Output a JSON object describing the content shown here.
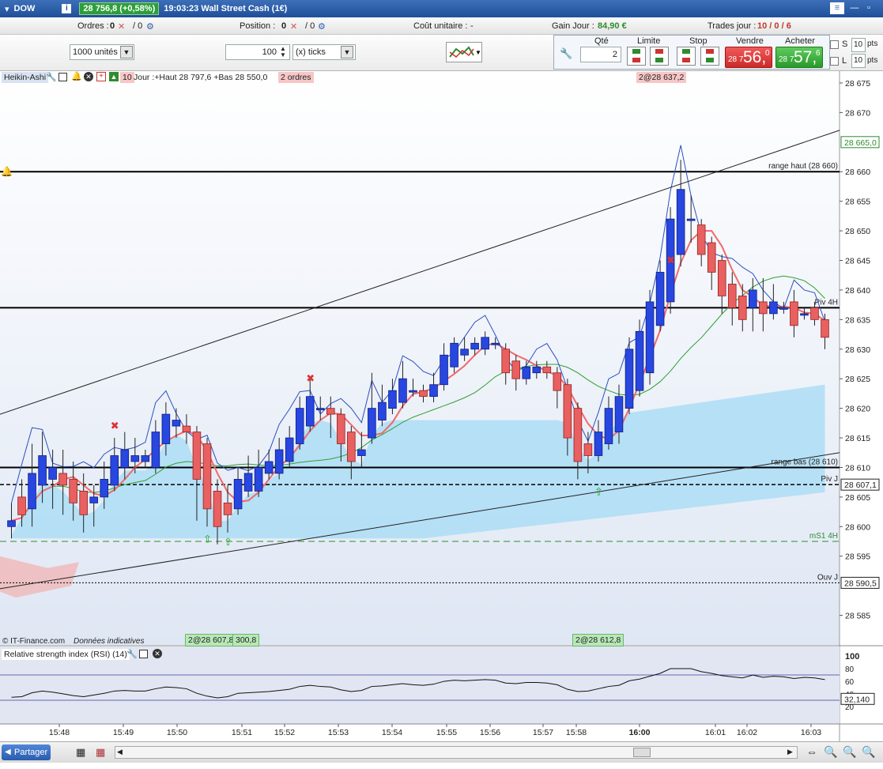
{
  "titlebar": {
    "instrument": "DOW",
    "price": "28 756,8 (+0,58%)",
    "info": "19:03:23 Wall Street Cash (1€)"
  },
  "status": {
    "orders_label": "Ordres :",
    "orders_val": "0",
    "orders_val2": "/ 0",
    "position_label": "Position :",
    "position_val": "0",
    "position_val2": "/ 0",
    "cost_label": "Coût unitaire :",
    "cost_val": "-",
    "gain_label": "Gain Jour :",
    "gain_val": "84,90 €",
    "trades_label": "Trades jour :",
    "trades_val": "10 / 0 / 6"
  },
  "toolbar": {
    "units_select": "1000 unités",
    "qty_input": "100",
    "ticks_select": "(x) ticks",
    "qte_label": "Qté",
    "qte_val": "2",
    "limite_label": "Limite",
    "stop_label": "Stop",
    "vendre_label": "Vendre",
    "acheter_label": "Acheter",
    "sell_small": "28 7",
    "sell_big": "56,",
    "sell_sup": "0",
    "buy_small": "28 7",
    "buy_big": "57,",
    "buy_sup": "6",
    "s_label": "S",
    "l_label": "L",
    "s_pts": "10",
    "l_pts": "10",
    "pts_label": "pts"
  },
  "chart_header": {
    "indicator": "Heikin-Ashi",
    "info_text": "Jour :+Haut 28 797,6 +Bas 28 550,0",
    "small_tag": "10",
    "orders_tag": "2 ordres",
    "order_tag_right": "2@28 637,2"
  },
  "chart_data": {
    "type": "candlestick",
    "y_ticks": [
      "28 675",
      "28 670",
      "28 660",
      "28 655",
      "28 650",
      "28 645",
      "28 640",
      "28 635",
      "28 630",
      "28 625",
      "28 620",
      "28 615",
      "28 610",
      "28 605",
      "28 600",
      "28 595",
      "28 585"
    ],
    "x_ticks": [
      "15:48",
      "15:49",
      "15:50",
      "15:51",
      "15:52",
      "15:53",
      "15:54",
      "15:55",
      "15:56",
      "15:57",
      "15:58",
      "16:00",
      "16:01",
      "16:02",
      "16:03"
    ],
    "ylim": [
      28580,
      28677
    ],
    "price_tags": [
      {
        "label": "28 665,0",
        "value": 28665.0,
        "color": "#2e8b2e"
      },
      {
        "label": "28 607,1",
        "value": 28607.1,
        "color": "#222"
      },
      {
        "label": "28 590,5",
        "value": 28590.5,
        "color": "#222"
      }
    ],
    "levels": [
      {
        "label": "range haut (28 660)",
        "value": 28660,
        "style": "solid"
      },
      {
        "label": "Piv 4H",
        "value": 28637,
        "style": "solid"
      },
      {
        "label": "range bas (28 610)",
        "value": 28610,
        "style": "solid"
      },
      {
        "label": "Piv J",
        "value": 28607.1,
        "style": "dash"
      },
      {
        "label": "mS1 4H",
        "value": 28597.5,
        "style": "green-dash"
      },
      {
        "label": "Ouv J",
        "value": 28590.5,
        "style": "dot"
      }
    ],
    "candles": [
      {
        "o": 28600,
        "c": 28601,
        "h": 28604,
        "l": 28598
      },
      {
        "o": 28605,
        "c": 28602,
        "h": 28608,
        "l": 28600
      },
      {
        "o": 28603,
        "c": 28609,
        "h": 28614,
        "l": 28600
      },
      {
        "o": 28607,
        "c": 28612,
        "h": 28616,
        "l": 28604
      },
      {
        "o": 28608,
        "c": 28610,
        "h": 28613,
        "l": 28603
      },
      {
        "o": 28609,
        "c": 28607,
        "h": 28613,
        "l": 28602
      },
      {
        "o": 28608,
        "c": 28604,
        "h": 28611,
        "l": 28601
      },
      {
        "o": 28606,
        "c": 28602,
        "h": 28609,
        "l": 28599
      },
      {
        "o": 28604,
        "c": 28605,
        "h": 28607,
        "l": 28600
      },
      {
        "o": 28605,
        "c": 28608,
        "h": 28611,
        "l": 28603
      },
      {
        "o": 28607,
        "c": 28612,
        "h": 28615,
        "l": 28606
      },
      {
        "o": 28610,
        "c": 28613,
        "h": 28616,
        "l": 28608
      },
      {
        "o": 28611,
        "c": 28612,
        "h": 28615,
        "l": 28609
      },
      {
        "o": 28611,
        "c": 28612,
        "h": 28613,
        "l": 28610
      },
      {
        "o": 28610,
        "c": 28616,
        "h": 28618,
        "l": 28609
      },
      {
        "o": 28614,
        "c": 28619,
        "h": 28621,
        "l": 28612
      },
      {
        "o": 28617,
        "c": 28618,
        "h": 28620,
        "l": 28615
      },
      {
        "o": 28617,
        "c": 28616,
        "h": 28619,
        "l": 28614
      },
      {
        "o": 28616,
        "c": 28608,
        "h": 28617,
        "l": 28601
      },
      {
        "o": 28614,
        "c": 28603,
        "h": 28615,
        "l": 28600
      },
      {
        "o": 28606,
        "c": 28600,
        "h": 28608,
        "l": 28597
      },
      {
        "o": 28604,
        "c": 28602,
        "h": 28607,
        "l": 28599
      },
      {
        "o": 28603,
        "c": 28608,
        "h": 28610,
        "l": 28602
      },
      {
        "o": 28606,
        "c": 28609,
        "h": 28612,
        "l": 28605
      },
      {
        "o": 28606,
        "c": 28610,
        "h": 28613,
        "l": 28605
      },
      {
        "o": 28609,
        "c": 28611,
        "h": 28613,
        "l": 28608
      },
      {
        "o": 28609,
        "c": 28613,
        "h": 28615,
        "l": 28608
      },
      {
        "o": 28611,
        "c": 28615,
        "h": 28617,
        "l": 28610
      },
      {
        "o": 28614,
        "c": 28620,
        "h": 28622,
        "l": 28613
      },
      {
        "o": 28617,
        "c": 28622,
        "h": 28625,
        "l": 28616
      },
      {
        "o": 28620,
        "c": 28620,
        "h": 28622,
        "l": 28618
      },
      {
        "o": 28620,
        "c": 28619,
        "h": 28622,
        "l": 28615
      },
      {
        "o": 28619,
        "c": 28614,
        "h": 28620,
        "l": 28611
      },
      {
        "o": 28616,
        "c": 28611,
        "h": 28617,
        "l": 28608
      },
      {
        "o": 28612,
        "c": 28613,
        "h": 28616,
        "l": 28610
      },
      {
        "o": 28615,
        "c": 28620,
        "h": 28626,
        "l": 28614
      },
      {
        "o": 28618,
        "c": 28621,
        "h": 28624,
        "l": 28617
      },
      {
        "o": 28620,
        "c": 28623,
        "h": 28625,
        "l": 28619
      },
      {
        "o": 28621,
        "c": 28625,
        "h": 28628,
        "l": 28620
      },
      {
        "o": 28623,
        "c": 28623,
        "h": 28625,
        "l": 28622
      },
      {
        "o": 28623,
        "c": 28622,
        "h": 28624,
        "l": 28621
      },
      {
        "o": 28622,
        "c": 28624,
        "h": 28626,
        "l": 28621
      },
      {
        "o": 28624,
        "c": 28629,
        "h": 28631,
        "l": 28623
      },
      {
        "o": 28627,
        "c": 28631,
        "h": 28632,
        "l": 28626
      },
      {
        "o": 28629,
        "c": 28630,
        "h": 28632,
        "l": 28628
      },
      {
        "o": 28630,
        "c": 28631,
        "h": 28632,
        "l": 28629
      },
      {
        "o": 28630,
        "c": 28632,
        "h": 28633,
        "l": 28629
      },
      {
        "o": 28631,
        "c": 28631,
        "h": 28632,
        "l": 28630
      },
      {
        "o": 28630,
        "c": 28626,
        "h": 28631,
        "l": 28624
      },
      {
        "o": 28628,
        "c": 28625,
        "h": 28629,
        "l": 28623
      },
      {
        "o": 28625,
        "c": 28627,
        "h": 28628,
        "l": 28624
      },
      {
        "o": 28626,
        "c": 28627,
        "h": 28628,
        "l": 28625
      },
      {
        "o": 28627,
        "c": 28626,
        "h": 28628,
        "l": 28625
      },
      {
        "o": 28626,
        "c": 28623,
        "h": 28627,
        "l": 28620
      },
      {
        "o": 28624,
        "c": 28615,
        "h": 28625,
        "l": 28612
      },
      {
        "o": 28620,
        "c": 28611,
        "h": 28621,
        "l": 28608
      },
      {
        "o": 28614,
        "c": 28612,
        "h": 28616,
        "l": 28609
      },
      {
        "o": 28612,
        "c": 28616,
        "h": 28618,
        "l": 28611
      },
      {
        "o": 28614,
        "c": 28620,
        "h": 28622,
        "l": 28613
      },
      {
        "o": 28616,
        "c": 28622,
        "h": 28624,
        "l": 28614
      },
      {
        "o": 28620,
        "c": 28630,
        "h": 28632,
        "l": 28619
      },
      {
        "o": 28623,
        "c": 28633,
        "h": 28635,
        "l": 28622
      },
      {
        "o": 28626,
        "c": 28638,
        "h": 28640,
        "l": 28624
      },
      {
        "o": 28634,
        "c": 28643,
        "h": 28645,
        "l": 28633
      },
      {
        "o": 28638,
        "c": 28652,
        "h": 28654,
        "l": 28636
      },
      {
        "o": 28646,
        "c": 28657,
        "h": 28662,
        "l": 28644
      },
      {
        "o": 28652,
        "c": 28652,
        "h": 28656,
        "l": 28648
      },
      {
        "o": 28651,
        "c": 28646,
        "h": 28652,
        "l": 28644
      },
      {
        "o": 28648,
        "c": 28643,
        "h": 28649,
        "l": 28640
      },
      {
        "o": 28645,
        "c": 28639,
        "h": 28646,
        "l": 28636
      },
      {
        "o": 28641,
        "c": 28637,
        "h": 28643,
        "l": 28634
      },
      {
        "o": 28639,
        "c": 28635,
        "h": 28641,
        "l": 28633
      },
      {
        "o": 28637,
        "c": 28640,
        "h": 28642,
        "l": 28633
      },
      {
        "o": 28638,
        "c": 28636,
        "h": 28642,
        "l": 28633
      },
      {
        "o": 28636,
        "c": 28638,
        "h": 28641,
        "l": 28635
      },
      {
        "o": 28637,
        "c": 28637,
        "h": 28638,
        "l": 28636
      },
      {
        "o": 28638,
        "c": 28634,
        "h": 28640,
        "l": 28632
      },
      {
        "o": 28636,
        "c": 28636,
        "h": 28637,
        "l": 28635
      },
      {
        "o": 28637,
        "c": 28635,
        "h": 28638,
        "l": 28634
      },
      {
        "o": 28635,
        "c": 28632,
        "h": 28636,
        "l": 28630
      }
    ],
    "order_tags": [
      {
        "label": "2@28 607,8",
        "value": 28607.8
      },
      {
        "label": "2@28 612,8",
        "value": 28612.8
      }
    ],
    "order_tag_partial": "300,8",
    "copyright": "© IT-Finance.com",
    "data_note": "Données indicatives"
  },
  "rsi": {
    "title": "Relative strength index (RSI) (14)",
    "ticks": [
      "100",
      "80",
      "60",
      "40",
      "20"
    ],
    "current": "32,140"
  },
  "footer": {
    "share": "Partager"
  }
}
